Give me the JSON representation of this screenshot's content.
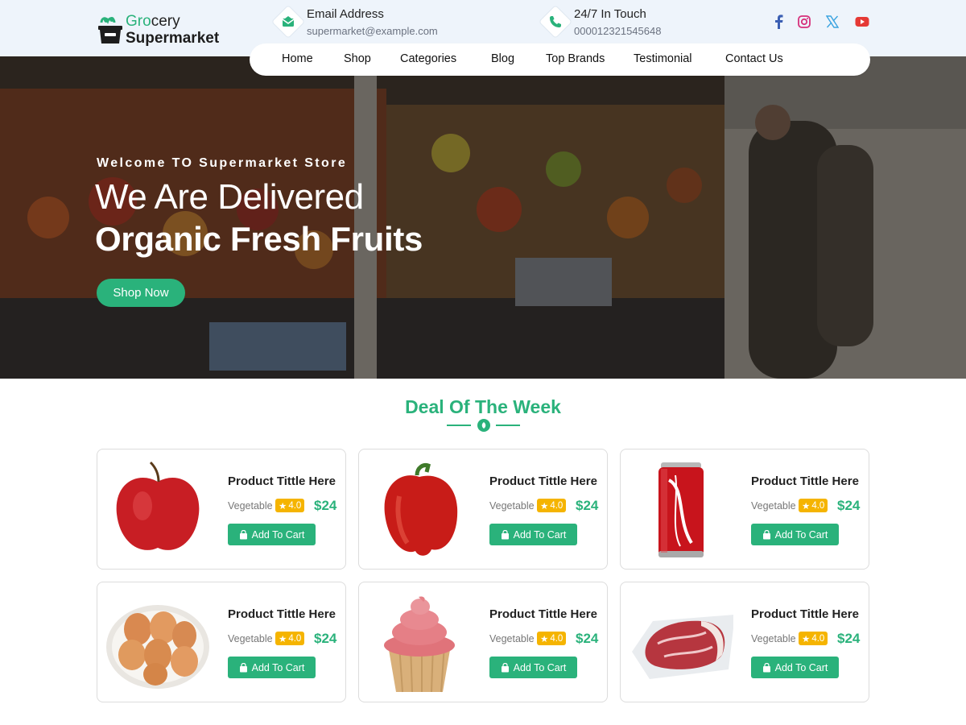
{
  "brand": {
    "logo_part1": "Gro",
    "logo_part2": "cery",
    "logo_line2": "Supermarket"
  },
  "contact": {
    "email_title": "Email Address",
    "email_value": "supermarket@example.com",
    "phone_title": "24/7 In Touch",
    "phone_value": "000012321545648"
  },
  "social": [
    "facebook-icon",
    "instagram-icon",
    "x-icon",
    "youtube-icon"
  ],
  "nav": {
    "items": [
      "Home",
      "Shop",
      "Categories",
      "Blog",
      "Top Brands",
      "Testimonial",
      "Contact Us"
    ]
  },
  "hero": {
    "kicker": "Welcome TO Supermarket Store",
    "line1": "We Are Delivered",
    "line2": "Organic Fresh Fruits",
    "button": "Shop Now"
  },
  "deals": {
    "title": "Deal Of The Week",
    "products": [
      {
        "image": "apple",
        "title": "Product Tittle  Here",
        "category": "Vegetable",
        "rating": "4.0",
        "price": "$24",
        "button": "Add To Cart"
      },
      {
        "image": "red-pepper",
        "title": "Product Tittle  Here",
        "category": "Vegetable",
        "rating": "4.0",
        "price": "$24",
        "button": "Add To Cart"
      },
      {
        "image": "cola-can",
        "title": "Product Tittle  Here",
        "category": "Vegetable",
        "rating": "4.0",
        "price": "$24",
        "button": "Add To Cart"
      },
      {
        "image": "eggs-bowl",
        "title": "Product Tittle  Here",
        "category": "Vegetable",
        "rating": "4.0",
        "price": "$24",
        "button": "Add To Cart"
      },
      {
        "image": "cupcake",
        "title": "Product Tittle  Here",
        "category": "Vegetable",
        "rating": "4.0",
        "price": "$24",
        "button": "Add To Cart"
      },
      {
        "image": "raw-meat",
        "title": "Product Tittle  Here",
        "category": "Vegetable",
        "rating": "4.0",
        "price": "$24",
        "button": "Add To Cart"
      }
    ]
  },
  "colors": {
    "accent": "#2ab27b",
    "rating": "#f5b400",
    "topbar": "#eef4fb"
  }
}
